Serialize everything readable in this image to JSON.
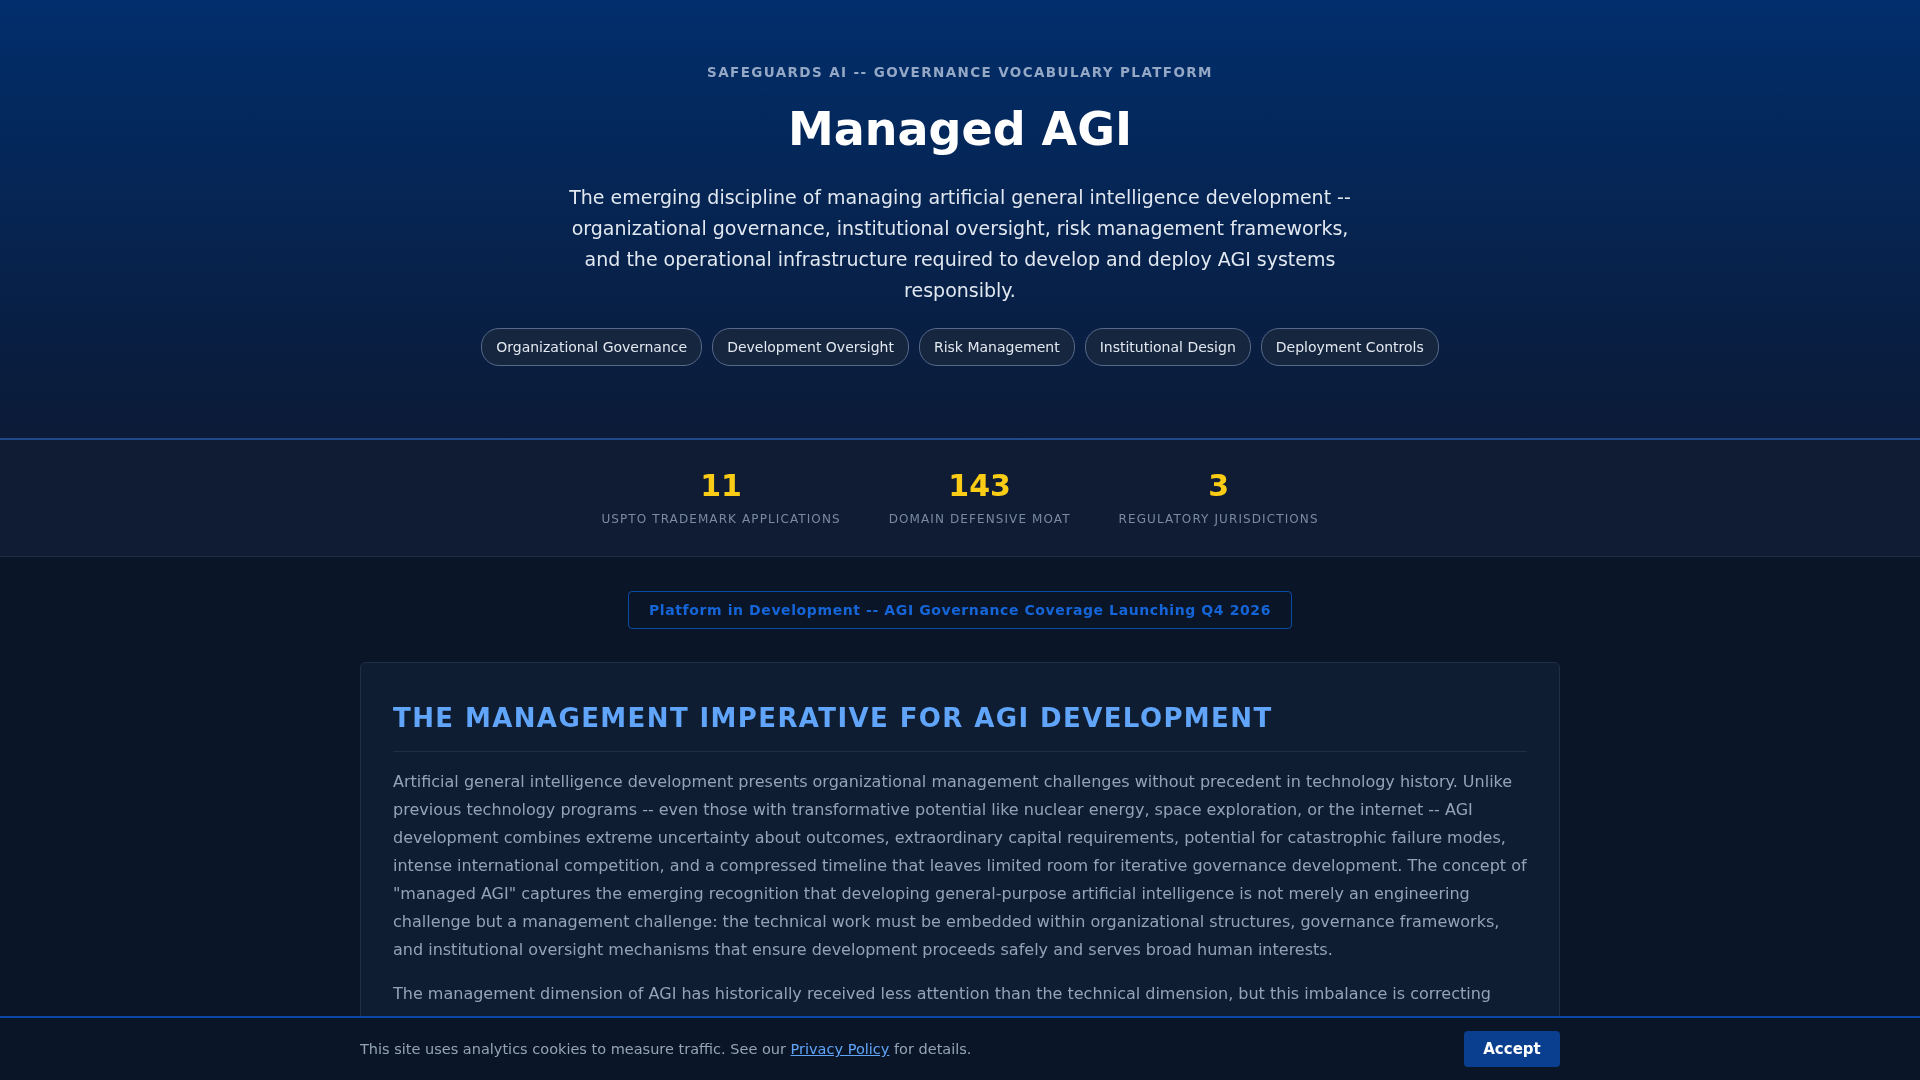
{
  "header": {
    "kicker": "SAFEGUARDS AI -- GOVERNANCE VOCABULARY PLATFORM",
    "title": "Managed AGI",
    "lead": "The emerging discipline of managing artificial general intelligence development -- organizational governance, institutional oversight, risk management frameworks, and the operational infrastructure required to develop and deploy AGI systems responsibly.",
    "tags": [
      "Organizational Governance",
      "Development Oversight",
      "Risk Management",
      "Institutional Design",
      "Deployment Controls"
    ]
  },
  "stats": [
    {
      "value": "11",
      "label": "USPTO TRADEMARK APPLICATIONS"
    },
    {
      "value": "143",
      "label": "DOMAIN DEFENSIVE MOAT"
    },
    {
      "value": "3",
      "label": "REGULATORY JURISDICTIONS"
    }
  ],
  "notice": "Platform in Development -- AGI Governance Coverage Launching Q4 2026",
  "section": {
    "heading": "THE MANAGEMENT IMPERATIVE FOR AGI DEVELOPMENT",
    "paragraphs": [
      "Artificial general intelligence development presents organizational management challenges without precedent in technology history. Unlike previous technology programs -- even those with transformative potential like nuclear energy, space exploration, or the internet -- AGI development combines extreme uncertainty about outcomes, extraordinary capital requirements, potential for catastrophic failure modes, intense international competition, and a compressed timeline that leaves limited room for iterative governance development. The concept of \"managed AGI\" captures the emerging recognition that developing general-purpose artificial intelligence is not merely an engineering challenge but a management challenge: the technical work must be embedded within organizational structures, governance frameworks, and institutional oversight mechanisms that ensure development proceeds safely and serves broad human interests.",
      "The management dimension of AGI has historically received less attention than the technical dimension, but this imbalance is correcting"
    ]
  },
  "cookie_bar": {
    "text_before": "This site uses analytics cookies to measure traffic. See our",
    "link": "Privacy Policy",
    "text_after": "for details.",
    "button": "Accept"
  }
}
